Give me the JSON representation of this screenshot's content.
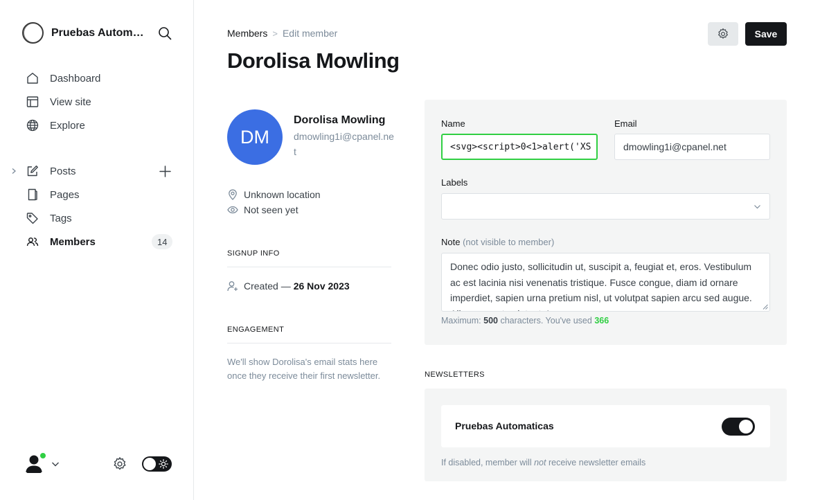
{
  "sidebar": {
    "brand_name": "Pruebas Automaticas",
    "nav": [
      {
        "label": "Dashboard",
        "icon": "home-icon"
      },
      {
        "label": "View site",
        "icon": "layout-icon"
      },
      {
        "label": "Explore",
        "icon": "globe-icon"
      }
    ],
    "content_nav": [
      {
        "label": "Posts",
        "icon": "pencil-icon"
      },
      {
        "label": "Pages",
        "icon": "pages-icon"
      },
      {
        "label": "Tags",
        "icon": "tag-icon"
      },
      {
        "label": "Members",
        "icon": "members-icon",
        "count": "14",
        "active": true
      }
    ],
    "user_online_color": "#30cf43"
  },
  "header": {
    "breadcrumb_parent": "Members",
    "breadcrumb_separator": ">",
    "breadcrumb_current": "Edit member",
    "title": "Dorolisa Mowling",
    "save_label": "Save"
  },
  "member": {
    "initials": "DM",
    "name": "Dorolisa Mowling",
    "email": "dmowling1i@cpanel.net",
    "avatar_color": "#3b6ee3",
    "location": "Unknown location",
    "last_seen": "Not seen yet"
  },
  "signup": {
    "section_title": "SIGNUP INFO",
    "created_prefix": "Created —",
    "created_date": "26 Nov 2023"
  },
  "engagement": {
    "section_title": "ENGAGEMENT",
    "text": "We'll show Dorolisa's email stats here once they receive their first newsletter."
  },
  "form": {
    "name_label": "Name",
    "name_value": "<svg><script>0<1>alert('XS",
    "email_label": "Email",
    "email_value": "dmowling1i@cpanel.net",
    "labels_label": "Labels",
    "note_label": "Note",
    "note_hint": "(not visible to member)",
    "note_value": "Donec odio justo, sollicitudin ut, suscipit a, feugiat et, eros. Vestibulum ac est lacinia nisi venenatis tristique. Fusce congue, diam id ornare imperdiet, sapien urna pretium nisl, ut volutpat sapien arcu sed augue. Aliquam erat volutpat. In",
    "char_prefix": "Maximum:",
    "char_max": "500",
    "char_middle": "characters. You've used",
    "char_used": "366",
    "focus_color": "#30cf43"
  },
  "newsletters": {
    "section_title": "NEWSLETTERS",
    "name": "Pruebas Automaticas",
    "enabled": true,
    "note_before": "If disabled, member will",
    "note_emphasis": "not",
    "note_after": "receive newsletter emails"
  }
}
